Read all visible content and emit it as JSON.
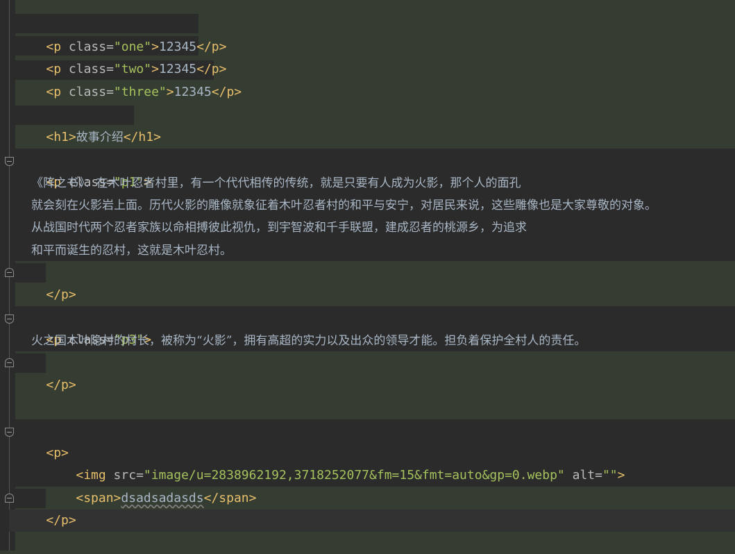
{
  "editor": {
    "language": "html",
    "lines": [
      {
        "p1_open": "<p",
        "p1_attr": " class=",
        "p1_val": "\"one\"",
        "p1_gt": ">",
        "p1_text": "12345",
        "p1_close": "</p>"
      },
      {
        "p2_open": "<p",
        "p2_attr": " class=",
        "p2_val": "\"two\"",
        "p2_gt": ">",
        "p2_text": "12345",
        "p2_close": "</p>"
      },
      {
        "p3_open": "<p",
        "p3_attr": " class=",
        "p3_val": "\"three\"",
        "p3_gt": ">",
        "p3_text": "12345",
        "p3_close": "</p>"
      }
    ],
    "h1": {
      "open": "<h1>",
      "text": "故事介绍",
      "close": "</h1>"
    },
    "block_p1": {
      "open_tag": "<p",
      "attr": " class=",
      "value": "\"p1\"",
      "gt": ">",
      "text_lines": [
        "《阵之书》：在木叶忍者村里，有一个代代相传的传统，就是只要有人成为火影，那个人的面孔",
        "就会刻在火影岩上面。历代火影的雕像就象征着木叶忍者村的和平与安宁，对居民来说，这些雕像也是大家尊敬的对象。",
        "从战国时代两个忍者家族以命相搏彼此视仇，到宇智波和千手联盟，建成忍者的桃源乡，为追求",
        "和平而诞生的忍村，这就是木叶忍村。"
      ],
      "close_tag": "</p>"
    },
    "block_p3": {
      "open_tag": "<p",
      "attr": " class=",
      "value": "\"p3\"",
      "gt": ">",
      "text": "火之国木叶隐村的村长，被称为“火影”，拥有高超的实力以及出众的领导才能。担负着保护全村人的责任。",
      "close_tag": "</p>"
    },
    "block_p_img": {
      "open_tag": "<p>",
      "img_tag": "<img",
      "src_attr": " src=",
      "src_value": "\"image/u=2838962192,3718252077&fm=15&fmt=auto&gp=0.webp\"",
      "alt_attr": " alt=",
      "alt_value": "\"\"",
      "img_end": ">",
      "span_open": "<span>",
      "span_text": "dsadsadasds",
      "span_close": "</span>",
      "close_tag": "</p>"
    }
  }
}
